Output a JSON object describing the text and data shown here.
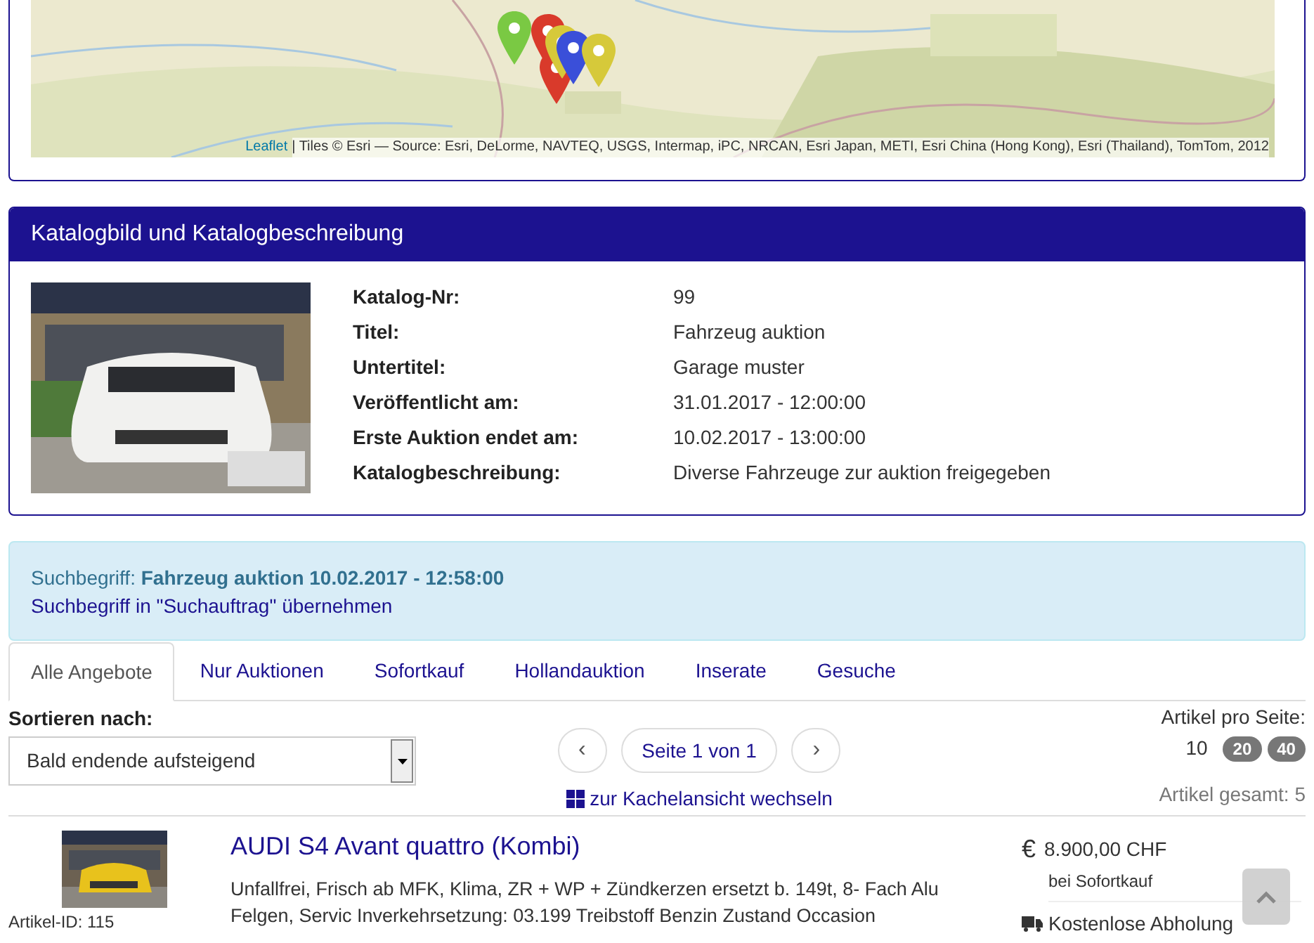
{
  "map": {
    "attribution_link": "Leaflet",
    "attribution": "| Tiles © Esri — Source: Esri, DeLorme, NAVTEQ, USGS, Intermap, iPC, NRCAN, Esri Japan, METI, Esri China (Hong Kong), Esri (Thailand), TomTom, 2012"
  },
  "catalog": {
    "title": "Katalogbild und Katalogbeschreibung",
    "fields": [
      {
        "label": "Katalog-Nr:",
        "value": "99"
      },
      {
        "label": "Titel:",
        "value": "Fahrzeug auktion"
      },
      {
        "label": "Untertitel:",
        "value": "Garage muster"
      },
      {
        "label": "Veröffentlicht am:",
        "value": "31.01.2017 - 12:00:00"
      },
      {
        "label": "Erste Auktion endet am:",
        "value": "10.02.2017 - 13:00:00"
      },
      {
        "label": "Katalogbeschreibung:",
        "value": "Diverse Fahrzeuge zur auktion freigegeben"
      }
    ]
  },
  "search": {
    "label": "Suchbegriff:",
    "term": "Fahrzeug auktion 10.02.2017 - 12:58:00",
    "link": "Suchbegriff in \"Suchauftrag\" übernehmen"
  },
  "tabs": [
    {
      "label": "Alle Angebote",
      "selected": true
    },
    {
      "label": "Nur Auktionen",
      "selected": false
    },
    {
      "label": "Sofortkauf",
      "selected": false
    },
    {
      "label": "Hollandauktion",
      "selected": false
    },
    {
      "label": "Inserate",
      "selected": false
    },
    {
      "label": "Gesuche",
      "selected": false
    }
  ],
  "sort": {
    "label": "Sortieren nach:",
    "value": "Bald endende aufsteigend"
  },
  "pagination": {
    "prev": "‹",
    "page": "Seite 1 von 1",
    "next": "›",
    "view_link": "zur Kachelansicht wechseln"
  },
  "per_page": {
    "label": "Artikel pro Seite:",
    "options": [
      {
        "label": "10",
        "selected": true
      },
      {
        "label": "20",
        "selected": false
      },
      {
        "label": "40",
        "selected": false
      }
    ],
    "total": "Artikel gesamt: 5"
  },
  "items": [
    {
      "article_id": "Artikel-ID: 115",
      "title": "AUDI S4 Avant quattro (Kombi)",
      "description": "Unfallfrei, Frisch ab MFK, Klima, ZR + WP + Zündkerzen ersetzt b. 149t, 8- Fach Alu Felgen, Servic Inverkehrsetzung: 03.199 Treibstoff Benzin Zustand Occasion",
      "currency": "€",
      "price": "8.900,00 CHF",
      "price_note": "bei Sofortkauf",
      "delivery": "Kostenlose Abholung"
    }
  ]
}
